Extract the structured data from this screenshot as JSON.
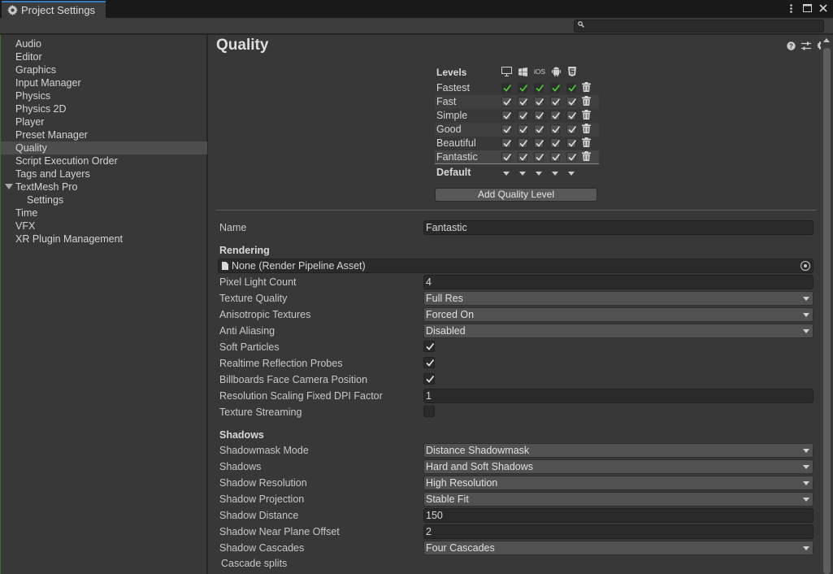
{
  "window": {
    "tab_title": "Project Settings",
    "search_placeholder": ""
  },
  "sidebar": {
    "items": [
      {
        "label": "Audio"
      },
      {
        "label": "Editor"
      },
      {
        "label": "Graphics"
      },
      {
        "label": "Input Manager"
      },
      {
        "label": "Physics"
      },
      {
        "label": "Physics 2D"
      },
      {
        "label": "Player"
      },
      {
        "label": "Preset Manager"
      },
      {
        "label": "Quality",
        "selected": true
      },
      {
        "label": "Script Execution Order"
      },
      {
        "label": "Tags and Layers"
      },
      {
        "label": "TextMesh Pro",
        "expanded": true
      },
      {
        "label": "Settings",
        "child": true
      },
      {
        "label": "Time"
      },
      {
        "label": "VFX"
      },
      {
        "label": "XR Plugin Management"
      }
    ]
  },
  "main": {
    "title": "Quality",
    "levels": {
      "header": "Levels",
      "platforms": [
        "standalone-icon",
        "windows-store-icon",
        "iOS",
        "android-icon",
        "webgl-icon"
      ],
      "platform_ios_label": "iOS",
      "rows": [
        {
          "name": "Fastest"
        },
        {
          "name": "Fast"
        },
        {
          "name": "Simple"
        },
        {
          "name": "Good"
        },
        {
          "name": "Beautiful"
        },
        {
          "name": "Fantastic",
          "selected": true
        }
      ],
      "default_label": "Default"
    },
    "add_level_label": "Add Quality Level",
    "name_label": "Name",
    "name_value": "Fantastic",
    "rendering": {
      "header": "Rendering",
      "pipeline_asset": "None (Render Pipeline Asset)",
      "pixel_light_count_label": "Pixel Light Count",
      "pixel_light_count": "4",
      "texture_quality_label": "Texture Quality",
      "texture_quality": "Full Res",
      "anisotropic_label": "Anisotropic Textures",
      "anisotropic": "Forced On",
      "anti_aliasing_label": "Anti Aliasing",
      "anti_aliasing": "Disabled",
      "soft_particles_label": "Soft Particles",
      "soft_particles": true,
      "reflection_probes_label": "Realtime Reflection Probes",
      "reflection_probes": true,
      "billboards_label": "Billboards Face Camera Position",
      "billboards": true,
      "dpi_label": "Resolution Scaling Fixed DPI Factor",
      "dpi": "1",
      "streaming_label": "Texture Streaming",
      "streaming": false
    },
    "shadows": {
      "header": "Shadows",
      "shadowmask_label": "Shadowmask Mode",
      "shadowmask": "Distance Shadowmask",
      "shadows_label": "Shadows",
      "shadows": "Hard and Soft Shadows",
      "resolution_label": "Shadow Resolution",
      "resolution": "High Resolution",
      "projection_label": "Shadow Projection",
      "projection": "Stable Fit",
      "distance_label": "Shadow Distance",
      "distance": "150",
      "near_plane_label": "Shadow Near Plane Offset",
      "near_plane": "2",
      "cascades_label": "Shadow Cascades",
      "cascades": "Four Cascades",
      "cascade_splits_label": "Cascade splits"
    }
  },
  "colors": {
    "accent": "#3a79bb",
    "check_green": "#4fc33a"
  }
}
